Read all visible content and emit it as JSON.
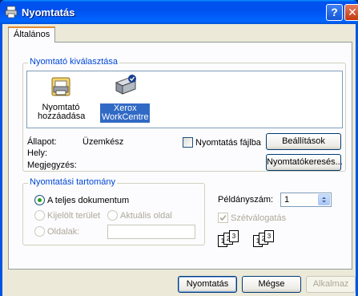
{
  "window": {
    "title": "Nyomtatás"
  },
  "tabs": [
    {
      "label": "Általános"
    }
  ],
  "select_printer": {
    "group_title": "Nyomtató kiválasztása",
    "items": [
      {
        "label_line1": "Nyomtató",
        "label_line2": "hozzáadása",
        "icon": "add-printer-icon"
      },
      {
        "label_line1": "Xerox",
        "label_line2": "WorkCentre",
        "icon": "printer-icon",
        "selected": true
      }
    ],
    "status_label": "Állapot:",
    "status_value": "Üzemkész",
    "location_label": "Hely:",
    "comment_label": "Megjegyzés:",
    "print_to_file_label": "Nyomtatás fájlba",
    "preferences_button": "Beállítások",
    "find_printer_button": "Nyomtatókeresés..."
  },
  "page_range": {
    "group_title": "Nyomtatási tartomány",
    "all_label": "A teljes dokumentum",
    "selection_label": "Kijelölt terület",
    "current_page_label": "Aktuális oldal",
    "pages_label": "Oldalak:",
    "pages_value": ""
  },
  "copies": {
    "label": "Példányszám:",
    "value": "1",
    "collate_label": "Szétválogatás",
    "collate_checked": true
  },
  "footer": {
    "print_button": "Nyomtatás",
    "cancel_button": "Mégse",
    "apply_button": "Alkalmaz"
  }
}
